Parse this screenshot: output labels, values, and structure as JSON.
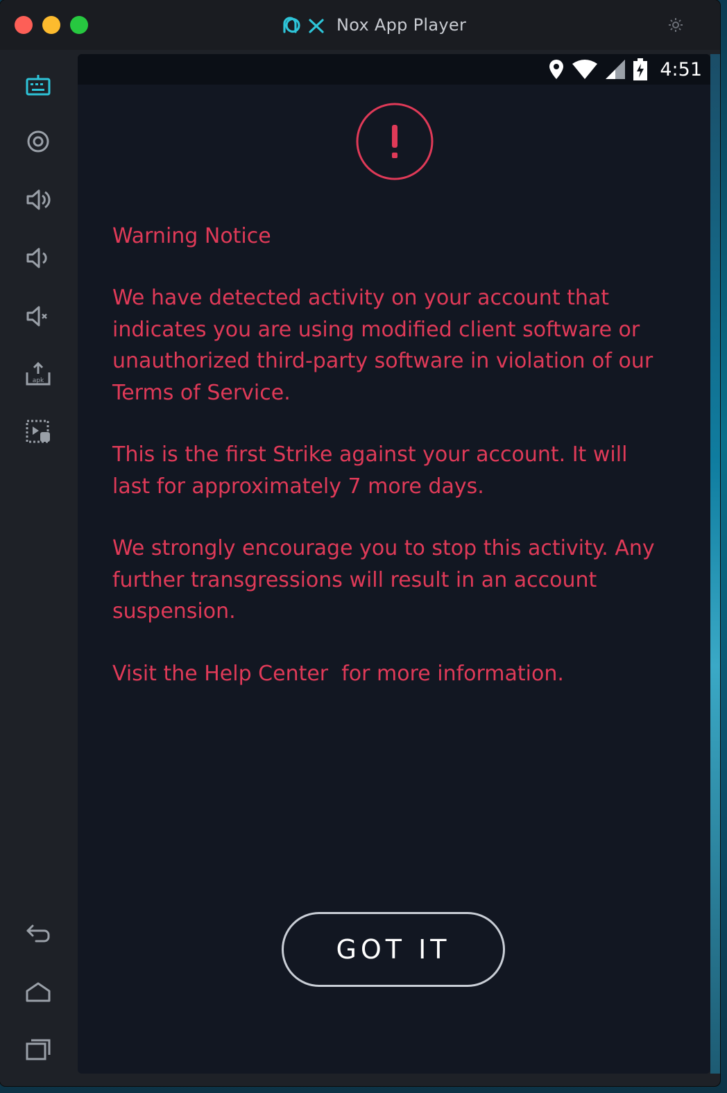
{
  "window": {
    "title": "Nox App Player"
  },
  "status_bar": {
    "time": "4:51"
  },
  "dialog": {
    "title": "Warning Notice",
    "paragraphs": [
      "We have detected activity on your account that indicates you are using modified client software or unauthorized third-party software in violation of our Terms of Service.",
      "This is the first Strike against your account. It will last for approximately 7 more days.",
      "We strongly encourage you to stop this activity. Any further transgressions will result in an account suspension.",
      "Visit the Help Center  for more information."
    ],
    "button_label": "GOT IT"
  },
  "sidebar_icons": [
    "keyboard-icon",
    "location-icon",
    "volume-up-icon",
    "volume-down-icon",
    "mute-icon",
    "apk-install-icon",
    "screen-record-icon",
    "back-icon",
    "home-icon",
    "recent-apps-icon"
  ],
  "colors": {
    "warning_text": "#e03a58",
    "accent": "#2ec4d8"
  }
}
